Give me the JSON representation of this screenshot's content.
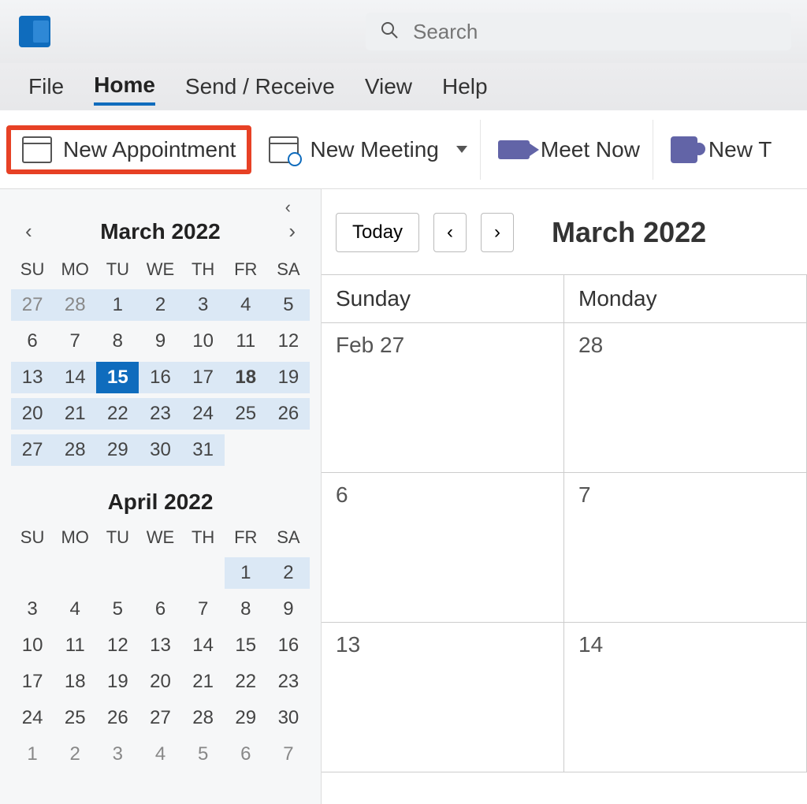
{
  "search": {
    "placeholder": "Search"
  },
  "menu": {
    "items": [
      "File",
      "Home",
      "Send / Receive",
      "View",
      "Help"
    ],
    "active_index": 1
  },
  "ribbon": {
    "new_appointment": "New Appointment",
    "new_meeting": "New Meeting",
    "meet_now": "Meet Now",
    "new_teams": "New T"
  },
  "sidebar": {
    "dow": [
      "SU",
      "MO",
      "TU",
      "WE",
      "TH",
      "FR",
      "SA"
    ],
    "cal1": {
      "title": "March 2022",
      "days": [
        {
          "n": "27",
          "muted": true,
          "shaded": true
        },
        {
          "n": "28",
          "muted": true,
          "shaded": true
        },
        {
          "n": "1",
          "shaded": true
        },
        {
          "n": "2",
          "shaded": true
        },
        {
          "n": "3",
          "shaded": true
        },
        {
          "n": "4",
          "shaded": true
        },
        {
          "n": "5",
          "shaded": true
        },
        {
          "n": "6"
        },
        {
          "n": "7"
        },
        {
          "n": "8"
        },
        {
          "n": "9"
        },
        {
          "n": "10"
        },
        {
          "n": "11"
        },
        {
          "n": "12"
        },
        {
          "n": "13",
          "shaded": true
        },
        {
          "n": "14",
          "shaded": true
        },
        {
          "n": "15",
          "selected": true
        },
        {
          "n": "16",
          "shaded": true
        },
        {
          "n": "17",
          "shaded": true
        },
        {
          "n": "18",
          "shaded": true,
          "bold": true
        },
        {
          "n": "19",
          "shaded": true
        },
        {
          "n": "20",
          "shaded": true
        },
        {
          "n": "21",
          "shaded": true
        },
        {
          "n": "22",
          "shaded": true
        },
        {
          "n": "23",
          "shaded": true
        },
        {
          "n": "24",
          "shaded": true
        },
        {
          "n": "25",
          "shaded": true
        },
        {
          "n": "26",
          "shaded": true
        },
        {
          "n": "27",
          "shaded": true
        },
        {
          "n": "28",
          "shaded": true
        },
        {
          "n": "29",
          "shaded": true
        },
        {
          "n": "30",
          "shaded": true
        },
        {
          "n": "31",
          "shaded": true
        },
        {
          "n": ""
        },
        {
          "n": ""
        }
      ]
    },
    "cal2": {
      "title": "April 2022",
      "days": [
        {
          "n": ""
        },
        {
          "n": ""
        },
        {
          "n": ""
        },
        {
          "n": ""
        },
        {
          "n": ""
        },
        {
          "n": "1",
          "shaded": true
        },
        {
          "n": "2",
          "shaded": true
        },
        {
          "n": "3"
        },
        {
          "n": "4"
        },
        {
          "n": "5"
        },
        {
          "n": "6"
        },
        {
          "n": "7"
        },
        {
          "n": "8"
        },
        {
          "n": "9"
        },
        {
          "n": "10"
        },
        {
          "n": "11"
        },
        {
          "n": "12"
        },
        {
          "n": "13"
        },
        {
          "n": "14"
        },
        {
          "n": "15"
        },
        {
          "n": "16"
        },
        {
          "n": "17"
        },
        {
          "n": "18"
        },
        {
          "n": "19"
        },
        {
          "n": "20"
        },
        {
          "n": "21"
        },
        {
          "n": "22"
        },
        {
          "n": "23"
        },
        {
          "n": "24"
        },
        {
          "n": "25"
        },
        {
          "n": "26"
        },
        {
          "n": "27"
        },
        {
          "n": "28"
        },
        {
          "n": "29"
        },
        {
          "n": "30"
        },
        {
          "n": "1",
          "muted": true
        },
        {
          "n": "2",
          "muted": true
        },
        {
          "n": "3",
          "muted": true
        },
        {
          "n": "4",
          "muted": true
        },
        {
          "n": "5",
          "muted": true
        },
        {
          "n": "6",
          "muted": true
        },
        {
          "n": "7",
          "muted": true
        }
      ]
    }
  },
  "calendar": {
    "today_label": "Today",
    "title": "March 2022",
    "day_headers": [
      "Sunday",
      "Monday"
    ],
    "rows": [
      [
        "Feb 27",
        "28"
      ],
      [
        "6",
        "7"
      ],
      [
        "13",
        "14"
      ]
    ]
  }
}
